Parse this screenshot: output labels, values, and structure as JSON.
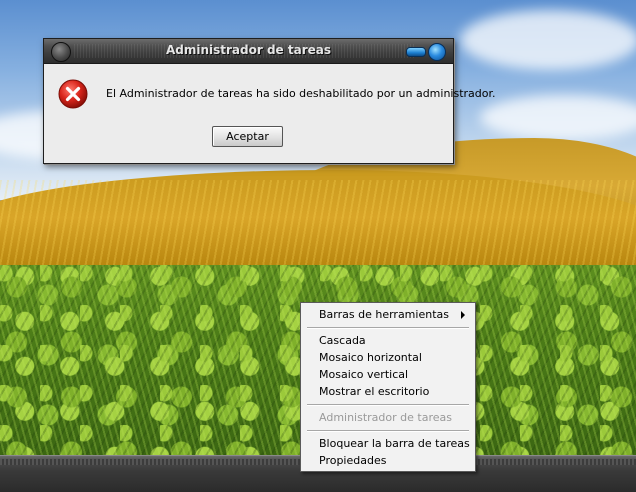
{
  "dialog": {
    "title": "Administrador de tareas",
    "message": "El Administrador de tareas ha sido deshabilitado por un administrador.",
    "accept_label": "Aceptar",
    "icon": "error-icon"
  },
  "context_menu": {
    "items": [
      {
        "label": "Barras de herramientas",
        "submenu": true,
        "enabled": true
      },
      {
        "label": "Cascada",
        "enabled": true
      },
      {
        "label": "Mosaico horizontal",
        "enabled": true
      },
      {
        "label": "Mosaico vertical",
        "enabled": true
      },
      {
        "label": "Mostrar el escritorio",
        "enabled": true
      },
      {
        "label": "Administrador de tareas",
        "enabled": false
      },
      {
        "label": "Bloquear la barra de tareas",
        "enabled": true
      },
      {
        "label": "Propiedades",
        "enabled": true
      }
    ]
  },
  "colors": {
    "error_red": "#d9261c",
    "titlebar": "#3d3d3d",
    "accent_blue": "#2a8be0",
    "disabled_text": "#9a9a9a"
  }
}
